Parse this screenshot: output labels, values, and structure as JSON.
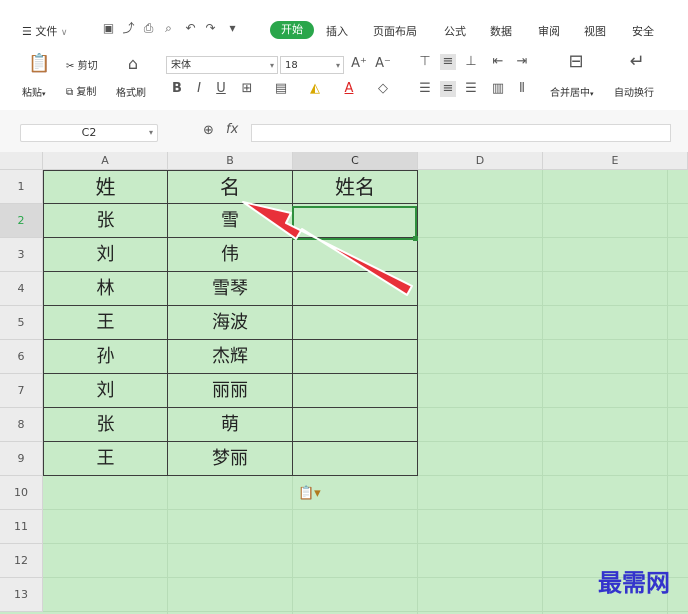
{
  "menubar": {
    "file_menu": "文件",
    "tabs": [
      {
        "label": "开始",
        "active": true
      },
      {
        "label": "插入"
      },
      {
        "label": "页面布局"
      },
      {
        "label": "公式"
      },
      {
        "label": "数据"
      },
      {
        "label": "审阅"
      },
      {
        "label": "视图"
      },
      {
        "label": "安全"
      }
    ]
  },
  "ribbon": {
    "paste_label": "粘贴",
    "cut_label": "剪切",
    "copy_label": "复制",
    "format_painter_label": "格式刷",
    "font_name": "宋体",
    "font_size": "18",
    "merge_label": "合并居中",
    "wrap_label": "自动换行"
  },
  "formula_bar": {
    "name_box": "C2",
    "fx_label": "fx",
    "formula": ""
  },
  "sheet": {
    "columns": [
      "A",
      "B",
      "C",
      "D",
      "E"
    ],
    "active_column": "C",
    "rows": [
      "1",
      "2",
      "3",
      "4",
      "5",
      "6",
      "7",
      "8",
      "9",
      "10",
      "11",
      "12",
      "13"
    ],
    "active_row": "2",
    "table_header": [
      "姓",
      "名",
      "姓名"
    ],
    "table_rows": [
      [
        "张",
        "雪",
        ""
      ],
      [
        "刘",
        "伟",
        ""
      ],
      [
        "林",
        "雪琴",
        ""
      ],
      [
        "王",
        "海波",
        ""
      ],
      [
        "孙",
        "杰辉",
        ""
      ],
      [
        "刘",
        "丽丽",
        ""
      ],
      [
        "张",
        "萌",
        ""
      ],
      [
        "王",
        "梦丽",
        ""
      ]
    ],
    "selected_cell": "C2"
  },
  "watermark": "最需网",
  "colors": {
    "accent": "#2aa64b",
    "sheet_background": "#c8ebc8",
    "arrow": "#e8303a",
    "watermark": "#3333cc"
  }
}
